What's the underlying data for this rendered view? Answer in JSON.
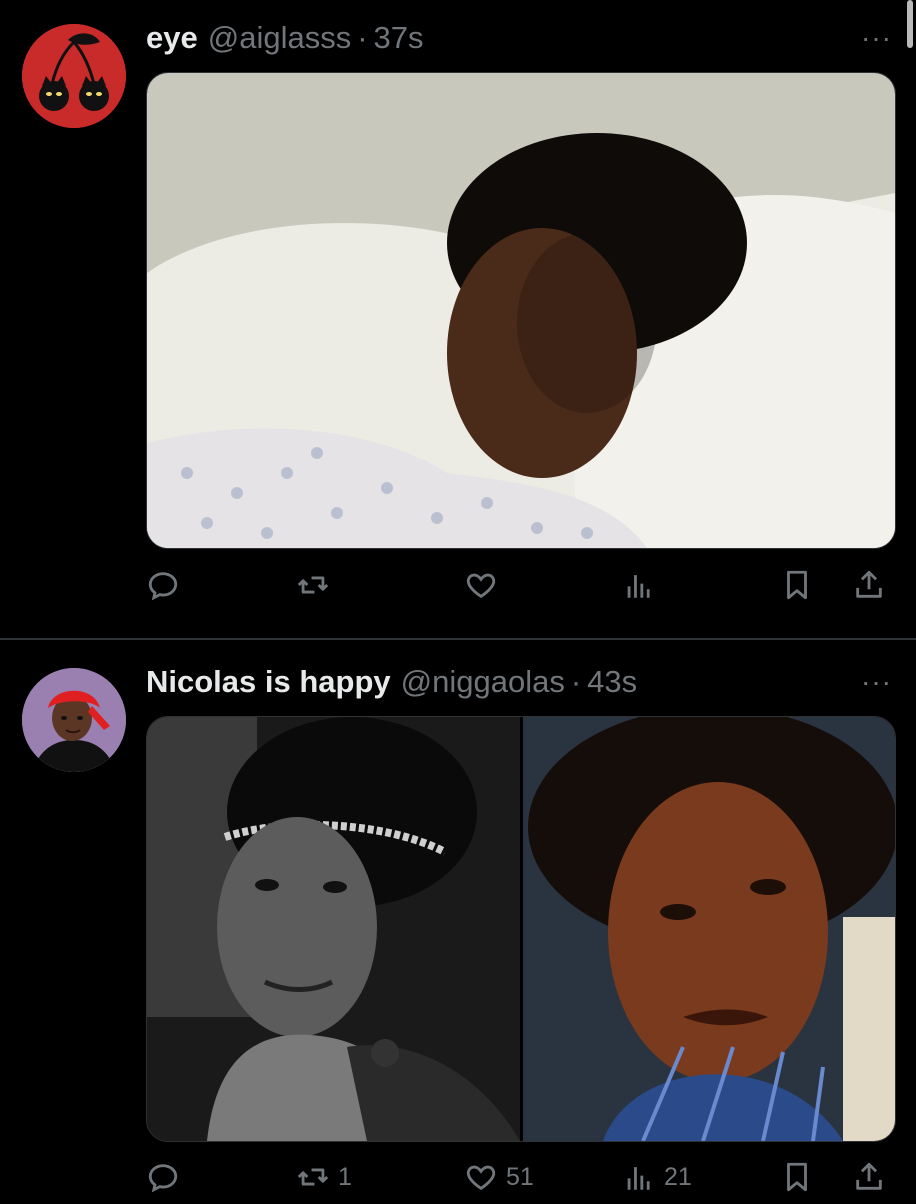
{
  "tweets": [
    {
      "display_name": "eye",
      "handle": "@aiglasss",
      "separator": "·",
      "time": "37s",
      "more_label": "···",
      "replies": "",
      "retweets": "",
      "likes": "",
      "views": "",
      "media_count": 1
    },
    {
      "display_name": "Nicolas is happy",
      "handle": "@niggaolas",
      "separator": "·",
      "time": "43s",
      "more_label": "···",
      "replies": "",
      "retweets": "1",
      "likes": "51",
      "views": "21",
      "media_count": 2
    }
  ],
  "colors": {
    "background": "#000000",
    "text_primary": "#e7e9ea",
    "text_secondary": "#71767b",
    "divider": "#2f3336"
  },
  "icons": [
    "reply-icon",
    "retweet-icon",
    "like-icon",
    "views-icon",
    "bookmark-icon",
    "share-icon",
    "more-icon"
  ]
}
